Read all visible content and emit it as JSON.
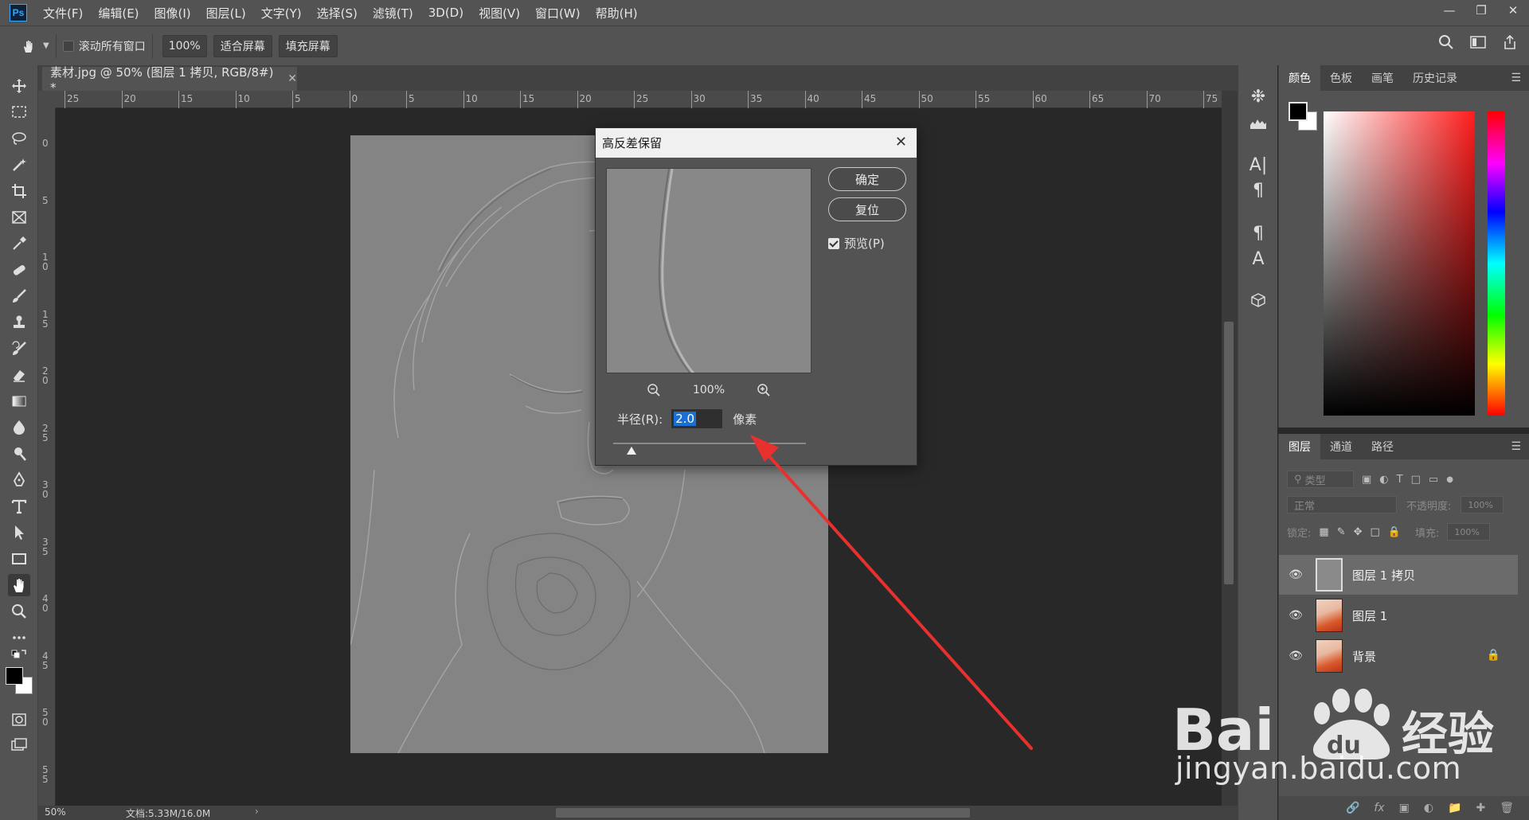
{
  "menubar": {
    "logo": "Ps",
    "items": [
      "文件(F)",
      "编辑(E)",
      "图像(I)",
      "图层(L)",
      "文字(Y)",
      "选择(S)",
      "滤镜(T)",
      "3D(D)",
      "视图(V)",
      "窗口(W)",
      "帮助(H)"
    ]
  },
  "options": {
    "scroll_all_label": "滚动所有窗口",
    "zoom_value": "100%",
    "fit_screen": "适合屏幕",
    "fill_screen": "填充屏幕"
  },
  "document": {
    "tab_title": "素材.jpg @ 50% (图层 1 拷贝, RGB/8#) *",
    "zoom": "50%",
    "doc_info": "文档:5.33M/16.0M",
    "ruler_h": [
      "25",
      "20",
      "15",
      "10",
      "5",
      "0",
      "5",
      "10",
      "15",
      "20",
      "25",
      "30",
      "35",
      "40",
      "45",
      "50",
      "55",
      "60",
      "65",
      "70",
      "75"
    ],
    "ruler_v": [
      "0",
      "5",
      "1 0",
      "1 5",
      "2 0",
      "2 5",
      "3 0",
      "3 5",
      "4 0",
      "4 5",
      "5 0",
      "5 5"
    ]
  },
  "dialog": {
    "title": "高反差保留",
    "ok": "确定",
    "reset": "复位",
    "preview_label": "预览(P)",
    "preview_checked": true,
    "zoom": "100%",
    "radius_label": "半径(R):",
    "radius_value": "2.0",
    "unit": "像素"
  },
  "color_panel": {
    "tabs": [
      "颜色",
      "色板",
      "画笔",
      "历史记录"
    ],
    "active_tab": "颜色"
  },
  "layers_panel": {
    "tabs": [
      "图层",
      "通道",
      "路径"
    ],
    "active_tab": "图层",
    "filter_placeholder": "类型",
    "blend_mode": "正常",
    "opacity_label": "不透明度:",
    "opacity_value": "100%",
    "lock_label": "锁定:",
    "fill_label": "填充:",
    "fill_value": "100%",
    "layers": [
      {
        "name": "图层 1 拷贝",
        "selected": true
      },
      {
        "name": "图层 1",
        "selected": false
      },
      {
        "name": "背景",
        "selected": false,
        "locked": true
      }
    ]
  },
  "watermark": {
    "brand_text": "Bai 经验",
    "url": "jingyan.baidu.com"
  },
  "colors": {
    "ui_dark": "#535353",
    "canvas_bg": "#282828",
    "selection_blue": "#1a6fd3",
    "arrow_red": "#e8312f"
  }
}
